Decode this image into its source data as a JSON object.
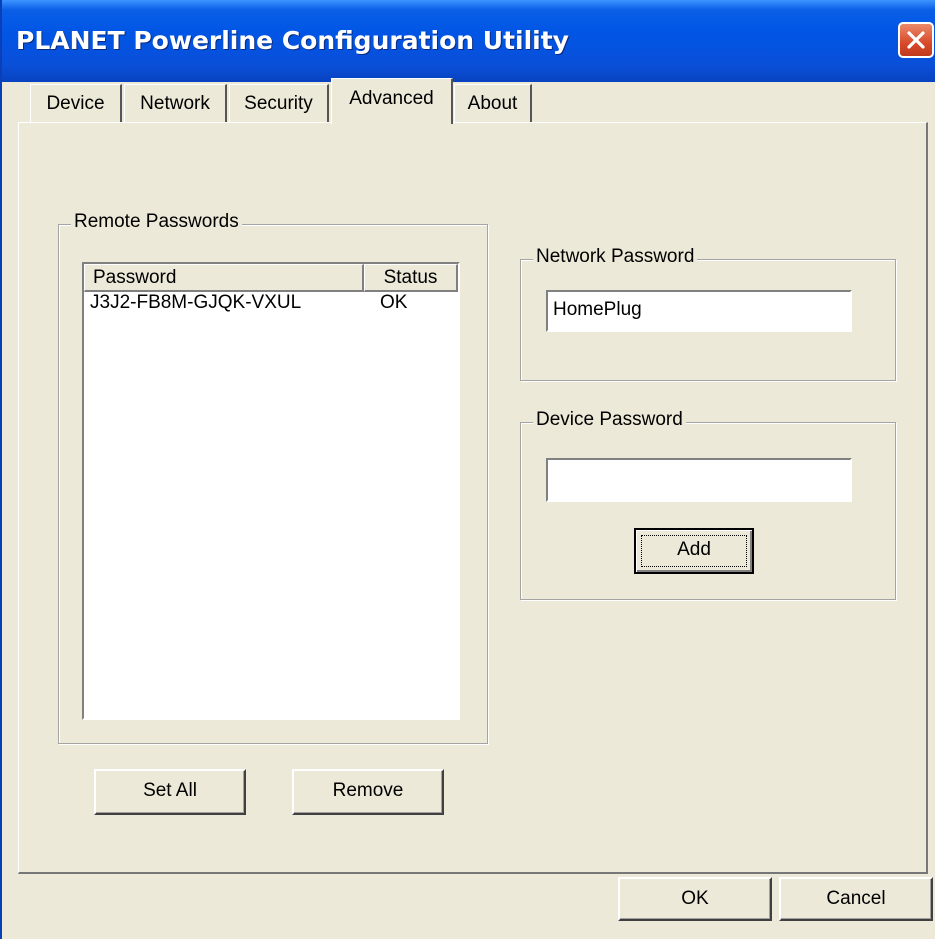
{
  "window": {
    "title": "PLANET Powerline Configuration Utility"
  },
  "tabs": [
    {
      "label": "Device"
    },
    {
      "label": "Network"
    },
    {
      "label": "Security"
    },
    {
      "label": "Advanced"
    },
    {
      "label": "About"
    }
  ],
  "active_tab": "Advanced",
  "remote_passwords": {
    "group_label": "Remote Passwords",
    "columns": [
      "Password",
      "Status"
    ],
    "rows": [
      {
        "password": "J3J2-FB8M-GJQK-VXUL",
        "status": "OK"
      }
    ],
    "set_all_label": "Set All",
    "remove_label": "Remove"
  },
  "network_password": {
    "group_label": "Network Password",
    "value": "HomePlug"
  },
  "device_password": {
    "group_label": "Device Password",
    "value": "",
    "add_label": "Add"
  },
  "footer": {
    "ok_label": "OK",
    "cancel_label": "Cancel"
  }
}
